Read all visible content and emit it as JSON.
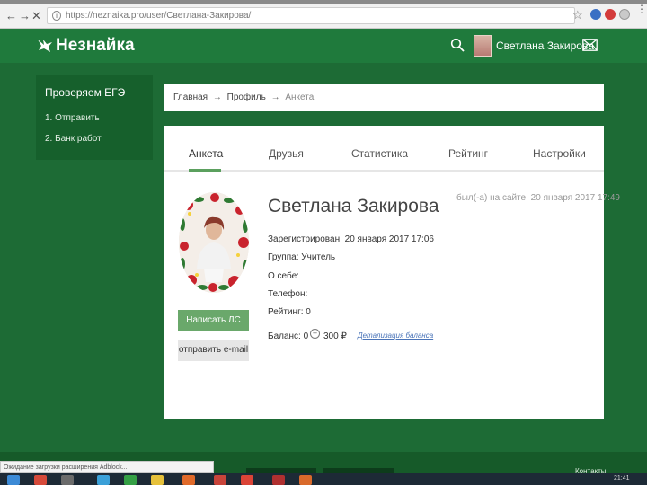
{
  "browser": {
    "url": "https://neznaika.pro/user/Светлана-Закирова/",
    "back_icon": "back-arrow-icon",
    "forward_icon": "forward-arrow-icon",
    "stop_icon": "close-icon"
  },
  "header": {
    "logo_text": "Незнайка",
    "user_name": "Светлана Закирова",
    "accent_color": "#1f7a3c"
  },
  "sidebar": {
    "title": "Проверяем ЕГЭ",
    "items": [
      {
        "label": "1. Отправить"
      },
      {
        "label": "2. Банк работ"
      }
    ]
  },
  "breadcrumb": {
    "home": "Главная",
    "sep1": "→",
    "profile": "Профиль",
    "sep2": "→",
    "current": "Анкета"
  },
  "tabs": [
    {
      "label": "Анкета",
      "active": true
    },
    {
      "label": "Друзья"
    },
    {
      "label": "Статистика"
    },
    {
      "label": "Рейтинг"
    },
    {
      "label": "Настройки"
    }
  ],
  "profile": {
    "name": "Светлана Закирова",
    "last_seen": "был(-а) на сайте: 20 января 2017 17:49",
    "registered": "Зарегистрирован: 20 января 2017 17:06",
    "group": "Группа: Учитель",
    "about": "О себе:",
    "phone": "Телефон:",
    "rating": "Рейтинг: 0",
    "balance": "Баланс: 0",
    "balance_amount": "300 ₽",
    "balance_link": "Детализация баланса",
    "write_button": "Написать ЛС",
    "mail_button": "отправить e-mail"
  },
  "footer": {
    "contacts": "Контакты",
    "status_text": "Ожидание загрузки расширения Adblock..."
  },
  "taskbar": {
    "time": "21:41"
  }
}
